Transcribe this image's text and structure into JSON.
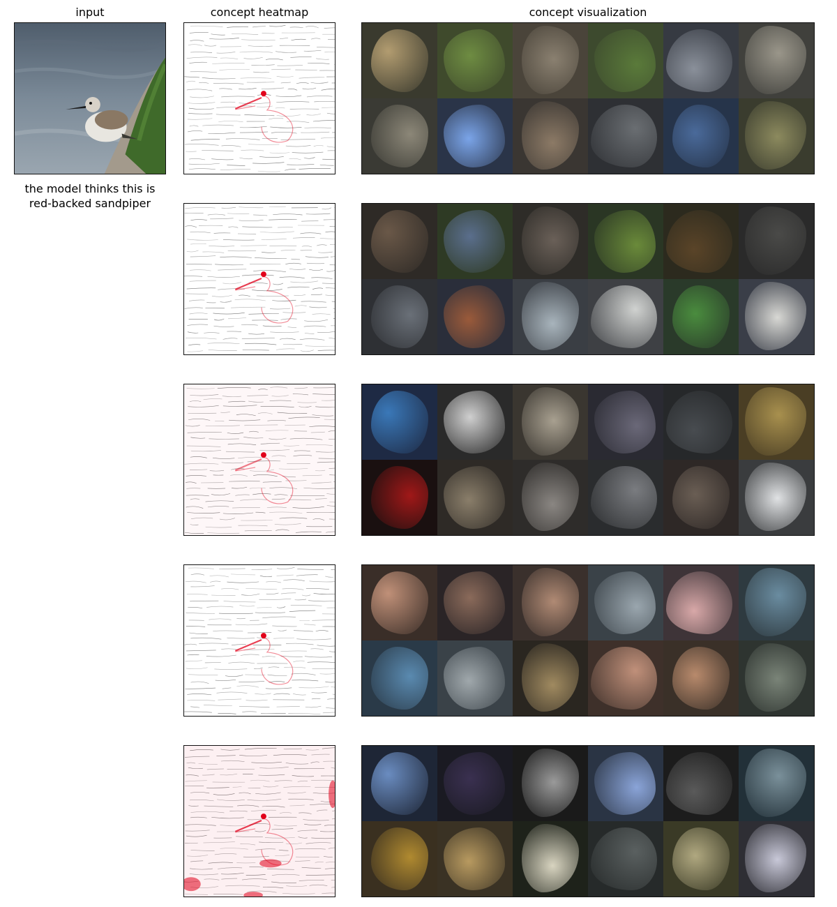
{
  "headers": {
    "input": "input",
    "heatmap": "concept heatmap",
    "visualization": "concept visualization"
  },
  "caption": {
    "line1": "the model thinks this is",
    "line2": "red-backed sandpiper"
  },
  "input_image": {
    "subject": "sandpiper on mossy rock by water",
    "colors": {
      "water": "#6f7d8c",
      "rock": "#a39a8c",
      "moss": "#3f6a2a",
      "bird_body": "#e8e6e0",
      "bird_back": "#8a7864",
      "beak": "#1c1c1c"
    }
  },
  "heatmap_colors": {
    "line": "#444444",
    "highlight": "#e2001a"
  },
  "concepts": [
    {
      "heat": "eye-beak",
      "tiles": [
        {
          "bg": "#3a3a2e",
          "fg": "#b29c70"
        },
        {
          "bg": "#3f4a2c",
          "fg": "#6e8c42"
        },
        {
          "bg": "#4a443a",
          "fg": "#8a8070"
        },
        {
          "bg": "#3d4a2e",
          "fg": "#5a7a3a"
        },
        {
          "bg": "#363a42",
          "fg": "#8a909a"
        },
        {
          "bg": "#40403c",
          "fg": "#9a968a"
        },
        {
          "bg": "#3a3a34",
          "fg": "#8c8778"
        },
        {
          "bg": "#2a3448",
          "fg": "#7aa4e8"
        },
        {
          "bg": "#3a3632",
          "fg": "#8c7a66"
        },
        {
          "bg": "#2e3034",
          "fg": "#6a6e72"
        },
        {
          "bg": "#26344a",
          "fg": "#4a6a9a"
        },
        {
          "bg": "#3a3c2e",
          "fg": "#8c8a5e"
        }
      ]
    },
    {
      "heat": "eye-beak",
      "tiles": [
        {
          "bg": "#2e2a26",
          "fg": "#6a5848"
        },
        {
          "bg": "#2e3a24",
          "fg": "#5a6e8c"
        },
        {
          "bg": "#2e2c28",
          "fg": "#6a6058"
        },
        {
          "bg": "#2a3624",
          "fg": "#6a8a3a"
        },
        {
          "bg": "#2c2a1e",
          "fg": "#5a4428"
        },
        {
          "bg": "#2a2a2a",
          "fg": "#4a4a48"
        },
        {
          "bg": "#2e3034",
          "fg": "#6a7078"
        },
        {
          "bg": "#2a2e3a",
          "fg": "#9a5a3a"
        },
        {
          "bg": "#3a3e44",
          "fg": "#a8b4bc"
        },
        {
          "bg": "#3e4044",
          "fg": "#d0d2d0"
        },
        {
          "bg": "#2a3a2a",
          "fg": "#4a8c3e"
        },
        {
          "bg": "#3a3e48",
          "fg": "#d8d8d4"
        }
      ]
    },
    {
      "heat": "faint-edges",
      "tiles": [
        {
          "bg": "#1e2a44",
          "fg": "#3a78b8"
        },
        {
          "bg": "#2a2a2a",
          "fg": "#cfcfcf"
        },
        {
          "bg": "#3a3630",
          "fg": "#a8a090"
        },
        {
          "bg": "#2a2a32",
          "fg": "#6a6878"
        },
        {
          "bg": "#26282a",
          "fg": "#484c50"
        },
        {
          "bg": "#4a3e24",
          "fg": "#a8904e"
        },
        {
          "bg": "#1a1010",
          "fg": "#a01818"
        },
        {
          "bg": "#2e2a26",
          "fg": "#8a7e6a"
        },
        {
          "bg": "#2e2c2a",
          "fg": "#8a8682"
        },
        {
          "bg": "#2a2c2e",
          "fg": "#7a7c80"
        },
        {
          "bg": "#2e2826",
          "fg": "#6a5e54"
        },
        {
          "bg": "#3a3c3e",
          "fg": "#e0e2e4"
        }
      ]
    },
    {
      "heat": "eye-beak",
      "tiles": [
        {
          "bg": "#3a2e28",
          "fg": "#c09078"
        },
        {
          "bg": "#2a2426",
          "fg": "#8a6a5a"
        },
        {
          "bg": "#3a302c",
          "fg": "#b08a74"
        },
        {
          "bg": "#3a4248",
          "fg": "#9aa6ae"
        },
        {
          "bg": "#3e3438",
          "fg": "#d8a8a8"
        },
        {
          "bg": "#2e3a40",
          "fg": "#6a8ca0"
        },
        {
          "bg": "#2a3a48",
          "fg": "#5a8ab0"
        },
        {
          "bg": "#3a4248",
          "fg": "#a0a8ac"
        },
        {
          "bg": "#2a2620",
          "fg": "#a08a60"
        },
        {
          "bg": "#3e302a",
          "fg": "#c0907a"
        },
        {
          "bg": "#3a3028",
          "fg": "#b88a6c"
        },
        {
          "bg": "#2e3430",
          "fg": "#7a8478"
        }
      ]
    },
    {
      "heat": "strong",
      "tiles": [
        {
          "bg": "#1e2636",
          "fg": "#6a8cc0"
        },
        {
          "bg": "#1a1a22",
          "fg": "#3a3050"
        },
        {
          "bg": "#1a1a1a",
          "fg": "#9a9a9a"
        },
        {
          "bg": "#2a3444",
          "fg": "#8aa4d8"
        },
        {
          "bg": "#1c1c1c",
          "fg": "#5a5a5a"
        },
        {
          "bg": "#223038",
          "fg": "#7a909a"
        },
        {
          "bg": "#3a3020",
          "fg": "#b08a30"
        },
        {
          "bg": "#3a3224",
          "fg": "#b89a60"
        },
        {
          "bg": "#1e221a",
          "fg": "#d8d4c0"
        },
        {
          "bg": "#262a2a",
          "fg": "#5a6060"
        },
        {
          "bg": "#3a3a26",
          "fg": "#b0a880"
        },
        {
          "bg": "#2e2e34",
          "fg": "#c8c8d8"
        }
      ]
    }
  ]
}
